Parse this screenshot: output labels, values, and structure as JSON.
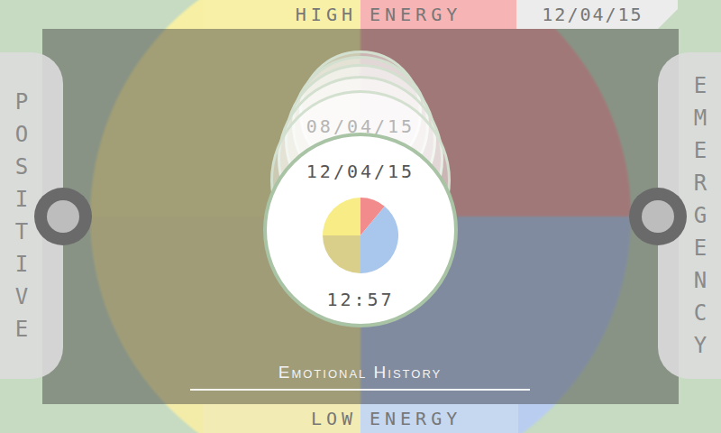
{
  "top_bar": {
    "label_left": "HIGH",
    "label_right": "ENERGY",
    "date": "12/04/15"
  },
  "bottom_bar": {
    "label_left": "LOW",
    "label_right": "ENERGY"
  },
  "left_panel": {
    "label": "POSITIVE"
  },
  "right_panel": {
    "label": "EMERGENCY"
  },
  "quadrants": [
    {
      "name": "high-positive",
      "color": "#f6efa4"
    },
    {
      "name": "high-emergency",
      "color": "#f5a9a9"
    },
    {
      "name": "low-positive",
      "color": "#f3eca8"
    },
    {
      "name": "low-emergency",
      "color": "#b9cdf0"
    }
  ],
  "history": [
    {
      "date": "08/04/15"
    },
    {},
    {},
    {},
    {}
  ],
  "current_entry": {
    "date": "12/04/15",
    "time": "12:57",
    "chart": {
      "segments": [
        {
          "value": 0.11,
          "color": "#f28b8b"
        },
        {
          "value": 0.39,
          "color": "#a9c6ec"
        },
        {
          "value": 0.25,
          "color": "#dacf8a"
        },
        {
          "value": 0.25,
          "color": "#f8ec86"
        }
      ]
    }
  },
  "section_title": "Emotional History"
}
